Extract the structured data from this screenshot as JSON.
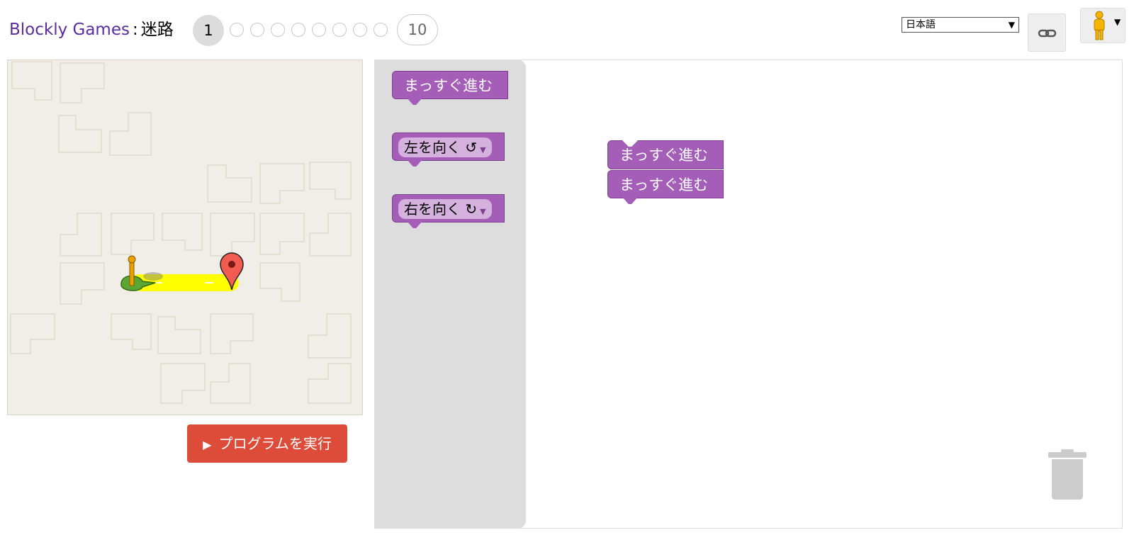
{
  "header": {
    "brand": "Blockly Games",
    "separator": ":",
    "game_name": "迷路",
    "levels": {
      "current": "1",
      "last": "10"
    },
    "language": "日本語"
  },
  "maze": {
    "start_icon": "pegman-icon",
    "goal_icon": "goal-marker-icon"
  },
  "run_button": {
    "label": "プログラムを実行",
    "icon": "play-icon"
  },
  "toolbox": {
    "blocks": [
      {
        "label": "まっすぐ進む"
      },
      {
        "label": "左を向く",
        "rotate_glyph": "↺",
        "arrow": "▼"
      },
      {
        "label": "右を向く",
        "rotate_glyph": "↻",
        "arrow": "▼"
      }
    ]
  },
  "workspace": {
    "blocks": [
      {
        "label": "まっすぐ進む"
      },
      {
        "label": "まっすぐ進む"
      }
    ]
  },
  "colors": {
    "block": "#a55eb7",
    "run_button": "#dd4b39",
    "brand": "#5b2c9e",
    "path": "#ffff00"
  }
}
